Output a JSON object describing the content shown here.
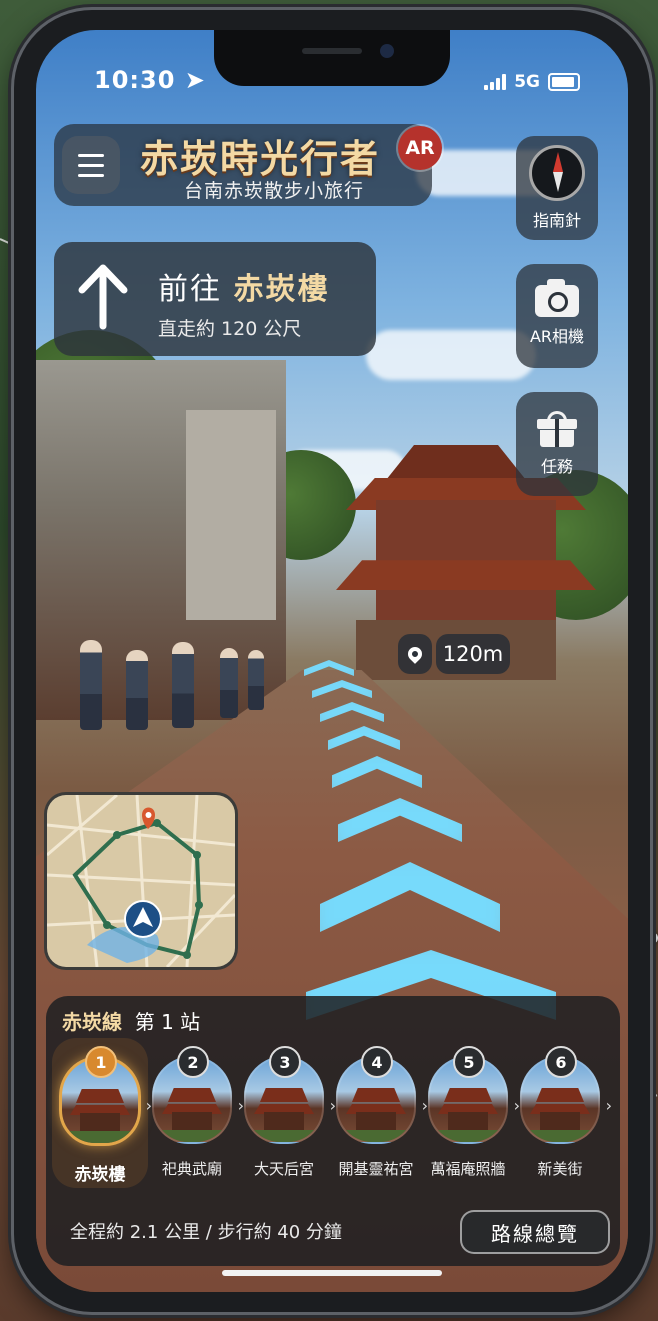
{
  "status_bar": {
    "time": "10:30",
    "network": "5G"
  },
  "header": {
    "title": "赤崁時光行者",
    "subtitle": "台南赤崁散步小旅行",
    "ar_badge": "AR"
  },
  "tools": [
    {
      "label": "指南針",
      "icon": "compass-icon"
    },
    {
      "label": "AR相機",
      "icon": "camera-icon"
    },
    {
      "label": "任務",
      "icon": "gift-icon"
    }
  ],
  "direction": {
    "prefix": "前往",
    "destination": "赤崁樓",
    "detail": "直走約 120 公尺",
    "icon": "arrow-up-icon"
  },
  "distance_marker": {
    "value": "120m"
  },
  "route": {
    "line_name": "赤崁線",
    "station_label": "第 1 站",
    "stops": [
      {
        "num": "1",
        "name": "赤崁樓",
        "active": true
      },
      {
        "num": "2",
        "name": "祀典武廟"
      },
      {
        "num": "3",
        "name": "大天后宮"
      },
      {
        "num": "4",
        "name": "開基靈祐宮"
      },
      {
        "num": "5",
        "name": "萬福庵照牆"
      },
      {
        "num": "6",
        "name": "新美街"
      }
    ],
    "separator": "›",
    "summary": "全程約 2.1 公里 / 步行約 40 分鐘",
    "overview_button": "路線總覽"
  },
  "colors": {
    "accent_gold": "#f3d9a4",
    "ar_red": "#b5322c",
    "active_orange": "#d8892e",
    "nav_glow": "#6fe0ff"
  }
}
